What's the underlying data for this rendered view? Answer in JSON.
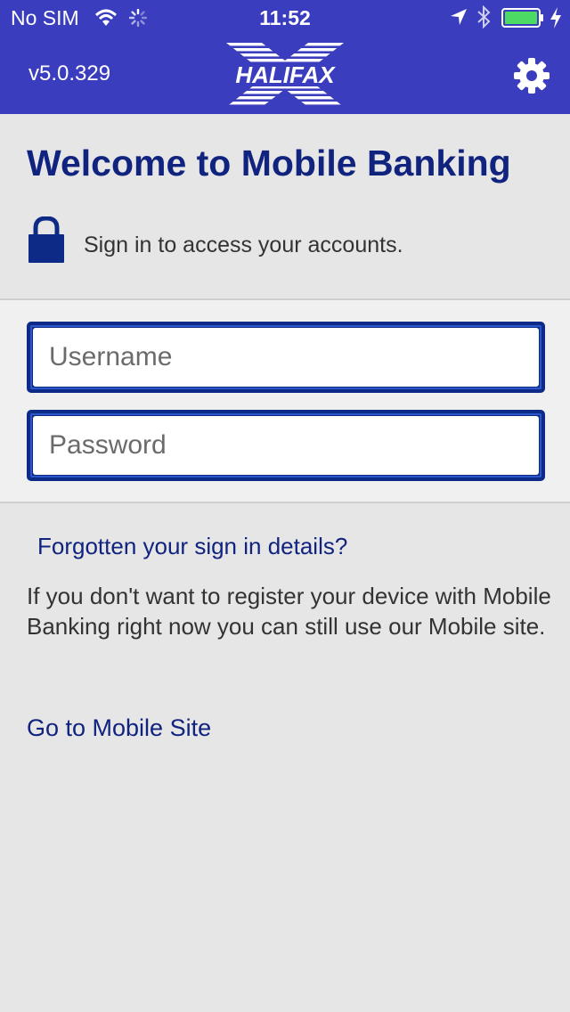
{
  "status_bar": {
    "carrier": "No SIM",
    "time": "11:52"
  },
  "header": {
    "version": "v5.0.329",
    "logo_text": "HALIFAX",
    "brand_color": "#3a3dbd"
  },
  "main": {
    "title": "Welcome to Mobile Banking",
    "signin_prompt": "Sign in to access your accounts."
  },
  "form": {
    "username_placeholder": "Username",
    "username_value": "",
    "password_placeholder": "Password",
    "password_value": ""
  },
  "links": {
    "forgot": "Forgotten your sign in details?",
    "info_text": "If you don't want to register your device with Mobile Banking right now you can still use our Mobile site.",
    "mobile_site": "Go to Mobile Site"
  },
  "icons": {
    "wifi": "wifi-icon",
    "activity": "activity-spinner-icon",
    "location": "location-arrow-icon",
    "bluetooth": "bluetooth-icon",
    "battery": "battery-icon",
    "charging": "charging-bolt-icon",
    "settings": "gear-icon",
    "lock": "lock-icon"
  }
}
